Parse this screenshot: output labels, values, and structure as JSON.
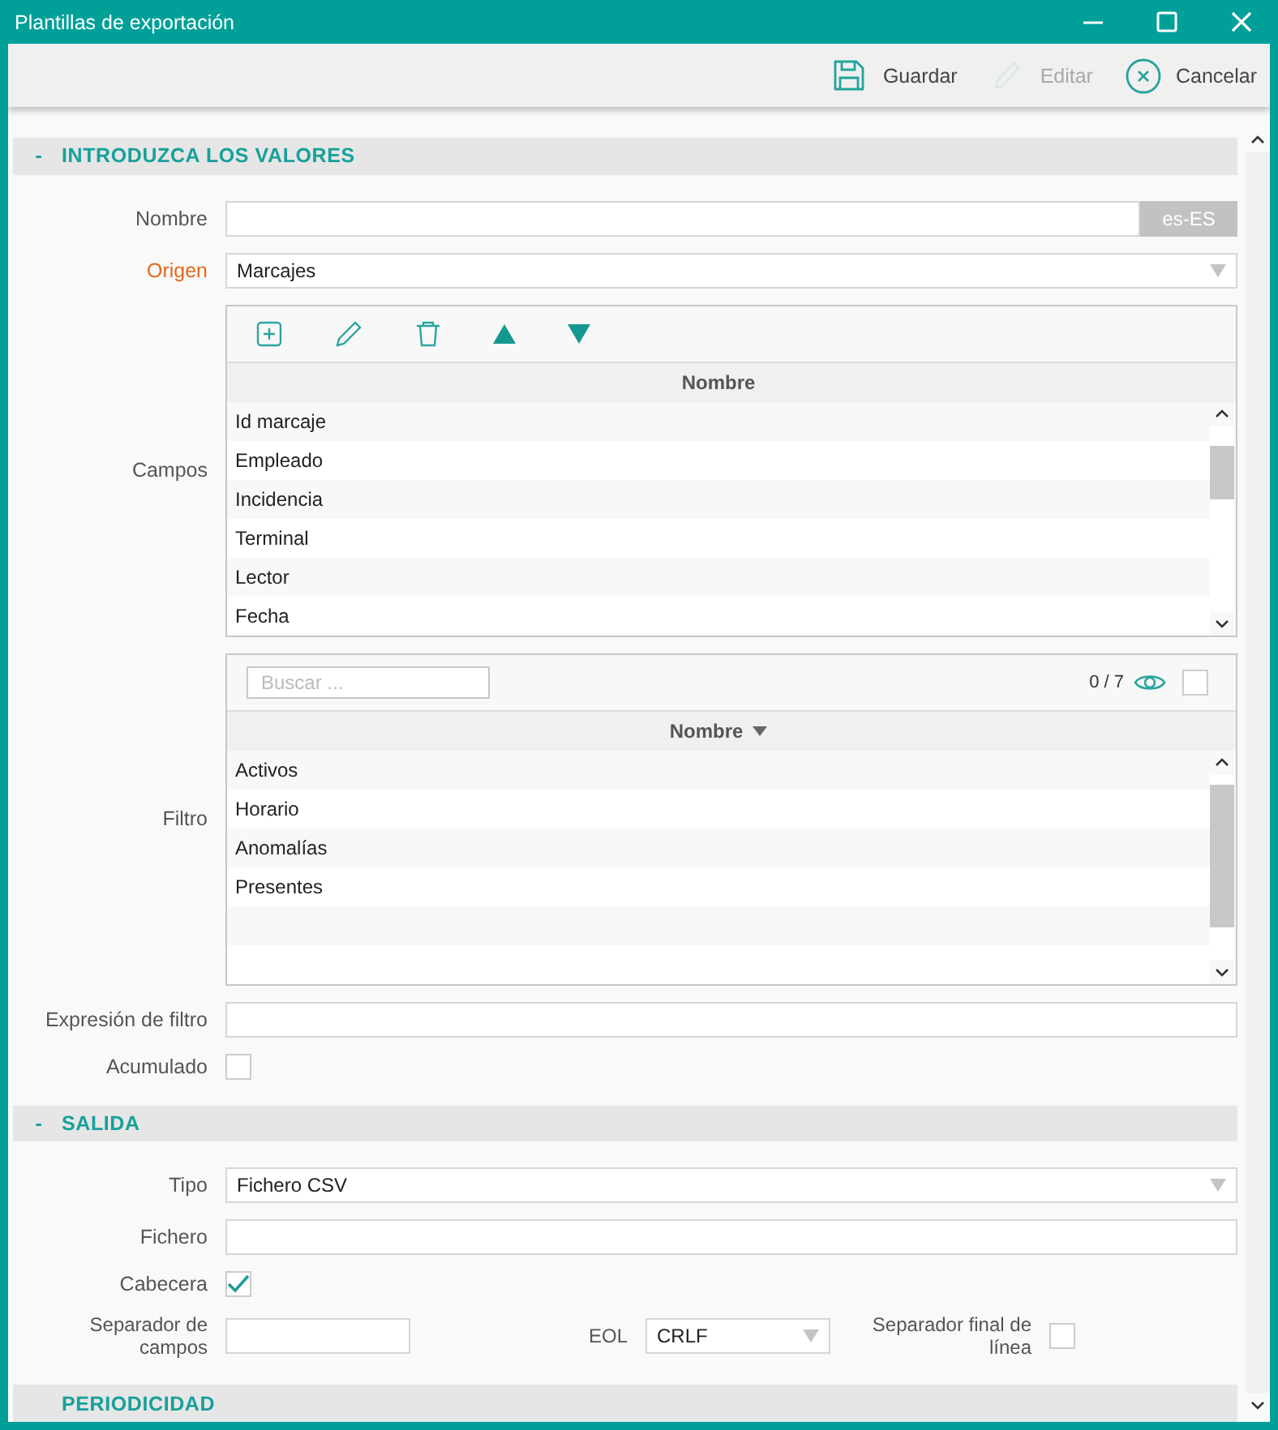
{
  "window": {
    "title": "Plantillas de exportación"
  },
  "toolbar": {
    "buttons": [
      {
        "kind": "save",
        "label": "Guardar",
        "disabled": false
      },
      {
        "kind": "edit",
        "label": "Editar",
        "disabled": true
      },
      {
        "kind": "cancel",
        "label": "Cancelar",
        "disabled": false
      }
    ]
  },
  "sections": [
    {
      "title": "INTRODUZCA LOS VALORES",
      "toggle": "-",
      "fields": [
        {
          "kind": "text",
          "label": "Nombre",
          "required": false,
          "addon": "es-ES"
        },
        {
          "kind": "select",
          "label": "Origen",
          "required": true,
          "value": "Marcajes"
        },
        {
          "kind": "grid",
          "label": "Campos",
          "required": false,
          "columns": [
            {
              "label": "Nombre",
              "sorted": false
            }
          ],
          "rows": [
            "Id marcaje",
            "Empleado",
            "Incidencia",
            "Terminal",
            "Lector",
            "Fecha"
          ]
        },
        {
          "kind": "filter_grid",
          "label": "Filtro",
          "required": false,
          "search": {
            "placeholder": "Buscar ..."
          },
          "count": "0 / 7",
          "select_all": {
            "checked": false
          },
          "columns": [
            {
              "label": "Nombre",
              "sorted": true
            }
          ],
          "rows": [
            "Activos",
            "Horario",
            "Anomalías",
            "Presentes"
          ]
        },
        {
          "kind": "text",
          "label": "Expresión de filtro",
          "required": false
        },
        {
          "kind": "checkbox",
          "label": "Acumulado",
          "required": false,
          "checked": false
        }
      ]
    },
    {
      "title": "SALIDA",
      "toggle": "-",
      "fields": [
        {
          "kind": "select",
          "label": "Tipo",
          "required": false,
          "value": "Fichero CSV"
        },
        {
          "kind": "text",
          "label": "Fichero",
          "required": false
        },
        {
          "kind": "checkbox",
          "label": "Cabecera",
          "required": false,
          "checked": true
        },
        {
          "kind": "row",
          "items": [
            {
              "kind": "text",
              "label": "Separador de campos",
              "required": false
            },
            {
              "kind": "select",
              "label": "EOL",
              "required": false,
              "value": "CRLF"
            },
            {
              "kind": "checkbox",
              "label": "Separador final de línea",
              "required": false,
              "checked": false
            }
          ]
        }
      ]
    },
    {
      "title": "PERIODICIDAD"
    }
  ]
}
